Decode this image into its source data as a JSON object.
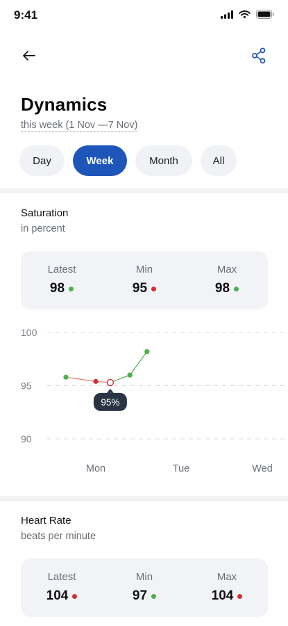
{
  "status_bar": {
    "time": "9:41",
    "icons": [
      "signal-icon",
      "wifi-icon",
      "battery-icon"
    ]
  },
  "nav": {
    "back_icon": "arrow-left-icon",
    "share_icon": "share-icon"
  },
  "header": {
    "title": "Dynamics",
    "subtitle": "this week (1 Nov —7 Nov)"
  },
  "tabs": [
    {
      "label": "Day",
      "active": false
    },
    {
      "label": "Week",
      "active": true
    },
    {
      "label": "Month",
      "active": false
    },
    {
      "label": "All",
      "active": false
    }
  ],
  "saturation": {
    "title": "Saturation",
    "unit": "in percent",
    "stats": [
      {
        "label": "Latest",
        "value": "98",
        "status": "green"
      },
      {
        "label": "Min",
        "value": "95",
        "status": "red"
      },
      {
        "label": "Max",
        "value": "98",
        "status": "green"
      }
    ]
  },
  "heart_rate": {
    "title": "Heart Rate",
    "unit": "beats per minute",
    "stats": [
      {
        "label": "Latest",
        "value": "104",
        "status": "red"
      },
      {
        "label": "Min",
        "value": "97",
        "status": "green"
      },
      {
        "label": "Max",
        "value": "104",
        "status": "red"
      }
    ]
  },
  "colors": {
    "accent": "#1e55b9",
    "green": "#4caf50",
    "red": "#d32f2f",
    "tooltip": "#2b3443",
    "line": "#e07f72"
  },
  "chart_data": {
    "type": "line",
    "y_ticks": [
      "100",
      "95",
      "90"
    ],
    "ylim": [
      90,
      100
    ],
    "x_labels": [
      "Mon",
      "Tue",
      "Wed"
    ],
    "points": [
      {
        "x": "Mon",
        "offset_days": -0.35,
        "y": 95.8,
        "status": "green"
      },
      {
        "x": "Mon",
        "offset_days": 0.0,
        "y": 95.4,
        "status": "red"
      },
      {
        "x": "Mon",
        "offset_days": 0.17,
        "y": 95.3,
        "status": "selected"
      },
      {
        "x": "Mon",
        "offset_days": 0.4,
        "y": 96.0,
        "status": "green"
      },
      {
        "x": "Mon",
        "offset_days": 0.6,
        "y": 98.2,
        "status": "green"
      }
    ],
    "tooltip": "95%"
  }
}
